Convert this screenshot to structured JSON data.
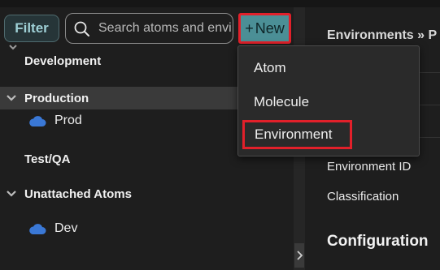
{
  "toolbar": {
    "filter_label": "Filter",
    "search_placeholder": "Search atoms and environments",
    "new_plus": "+",
    "new_label": "New"
  },
  "tree": {
    "groups": [
      {
        "label": "Development",
        "expanded": false
      },
      {
        "label": "Production",
        "expanded": true,
        "selected": true
      },
      {
        "label": "Test/QA",
        "expanded": false
      },
      {
        "label": "Unattached Atoms",
        "expanded": true
      }
    ],
    "leaves": [
      {
        "label": "Prod",
        "icon": "cloud-icon",
        "parent": "Production"
      },
      {
        "label": "Dev",
        "icon": "cloud-icon",
        "parent": "Unattached Atoms"
      }
    ]
  },
  "new_menu": {
    "items": [
      "Atom",
      "Molecule",
      "Environment"
    ],
    "highlighted": "Environment"
  },
  "details": {
    "breadcrumb": "Environments » P",
    "fields": [
      "Environment ID",
      "Classification"
    ],
    "section_title": "Configuration"
  },
  "colors": {
    "accent": "#4b8f96",
    "highlight_border": "#e2202a",
    "cloud": "#3a78d6",
    "selected_row": "#3a3a3a"
  }
}
